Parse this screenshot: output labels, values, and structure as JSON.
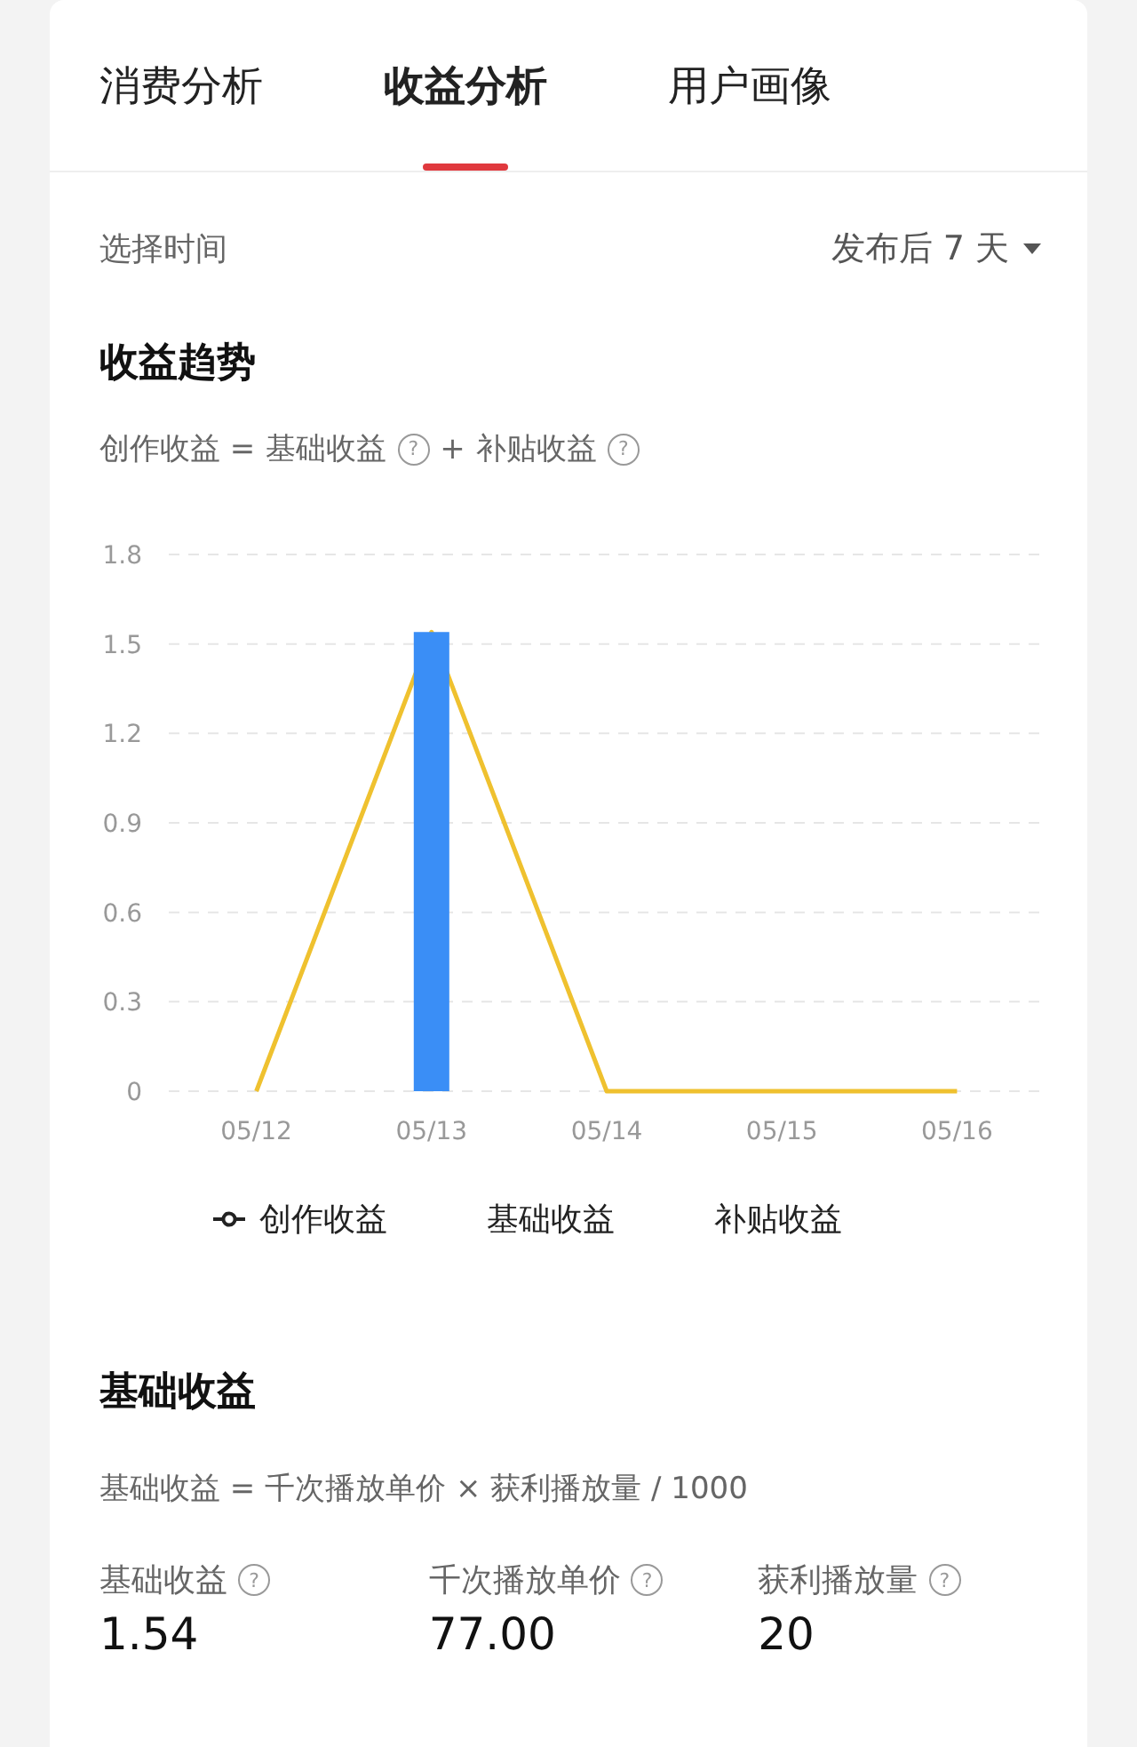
{
  "tabs": [
    {
      "label": "消费分析",
      "selected": false
    },
    {
      "label": "收益分析",
      "selected": true
    },
    {
      "label": "用户画像",
      "selected": false
    }
  ],
  "time_filter": {
    "label": "选择时间",
    "value": "发布后 7 天"
  },
  "trend": {
    "title": "收益趋势",
    "formula": [
      {
        "text": "创作收益 ="
      },
      {
        "text": "基础收益",
        "help": "?"
      },
      {
        "text": "+"
      },
      {
        "text": "补贴收益",
        "help": "?"
      }
    ],
    "chart_data": {
      "type": "bar",
      "grid": true,
      "categories": [
        "05/12",
        "05/13",
        "05/14",
        "05/15",
        "05/16"
      ],
      "ylim": [
        0,
        1.8
      ],
      "yticks": [
        {
          "value": 0,
          "label": "0"
        },
        {
          "value": 0.3,
          "label": "0.3"
        },
        {
          "value": 0.6,
          "label": "0.6"
        },
        {
          "value": 0.9,
          "label": "0.9"
        },
        {
          "value": 1.2,
          "label": "1.2"
        },
        {
          "value": 1.5,
          "label": "1.5"
        },
        {
          "value": 1.8,
          "label": "1.8"
        }
      ],
      "series": [
        {
          "name": "创作收益",
          "color": "#efc12f",
          "type": "line",
          "values": [
            0,
            1.54,
            0,
            0,
            0
          ]
        },
        {
          "name": "基础收益",
          "color": "#3a8ef6",
          "values": [
            0,
            1.54,
            0,
            0,
            0
          ]
        },
        {
          "name": "补贴收益",
          "color": "#efc12f",
          "values": [
            0,
            0,
            0,
            0,
            0
          ]
        }
      ]
    }
  },
  "basic": {
    "title": "基础收益",
    "formula": "基础收益 = 千次播放单价 × 获利播放量 / 1000",
    "metrics": [
      {
        "label": "基础收益",
        "help": "?",
        "value": "1.54"
      },
      {
        "label": "千次播放单价",
        "help": "?",
        "value": "77.00"
      },
      {
        "label": "获利播放量",
        "help": "?",
        "value": "20"
      }
    ]
  }
}
